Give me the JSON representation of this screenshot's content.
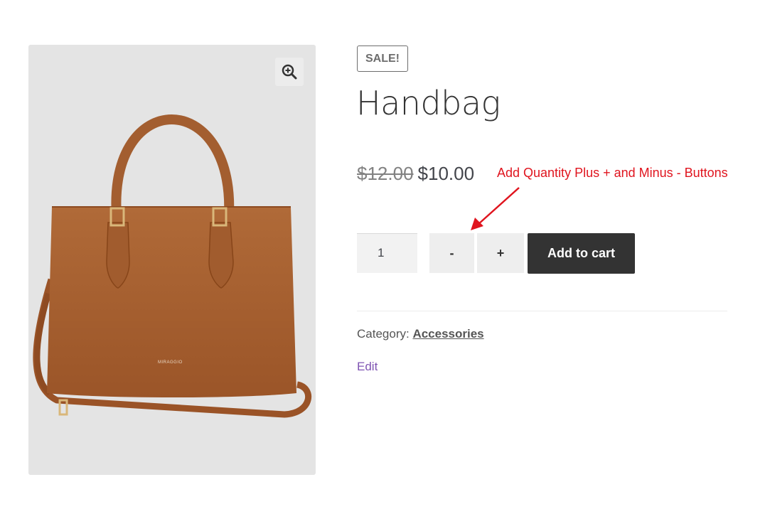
{
  "product": {
    "sale_badge": "SALE!",
    "title": "Handbag",
    "old_price": "$12.00",
    "price": "$10.00",
    "brand_mark": "MIRAGGIO",
    "category_label": "Category:",
    "category_link": "Accessories",
    "edit_link": "Edit"
  },
  "cart_form": {
    "quantity": "1",
    "minus_label": "-",
    "plus_label": "+",
    "add_to_cart_label": "Add to cart"
  },
  "annotation": {
    "text": "Add Quantity Plus + and Minus - Buttons",
    "color": "#e0141e"
  },
  "icons": {
    "zoom": "zoom-in-icon"
  },
  "colors": {
    "gallery_bg": "#e4e4e4",
    "bag": "#a8602f",
    "cart_button": "#333333",
    "edit_link": "#7f54b3"
  }
}
